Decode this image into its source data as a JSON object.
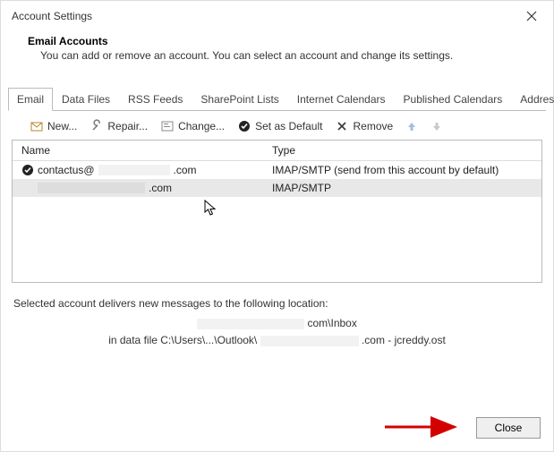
{
  "window": {
    "title": "Account Settings"
  },
  "header": {
    "title": "Email Accounts",
    "description": "You can add or remove an account. You can select an account and change its settings."
  },
  "tabs": [
    "Email",
    "Data Files",
    "RSS Feeds",
    "SharePoint Lists",
    "Internet Calendars",
    "Published Calendars",
    "Address Books"
  ],
  "toolbar": {
    "new": "New...",
    "repair": "Repair...",
    "change": "Change...",
    "default": "Set as Default",
    "remove": "Remove"
  },
  "list": {
    "headers": {
      "name": "Name",
      "type": "Type"
    },
    "rows": [
      {
        "name_prefix": "contactus@",
        "name_suffix": ".com",
        "type": "IMAP/SMTP (send from this account by default)",
        "default": true
      },
      {
        "name_prefix": "",
        "name_suffix": ".com",
        "type": "IMAP/SMTP",
        "default": false
      }
    ]
  },
  "selected_text": "Selected account delivers new messages to the following location:",
  "detail": {
    "line1_suffix": "com\\Inbox",
    "line2_prefix": "in data file C:\\Users\\...\\Outlook\\",
    "line2_suffix": ".com - jcreddy.ost"
  },
  "footer": {
    "close": "Close"
  }
}
